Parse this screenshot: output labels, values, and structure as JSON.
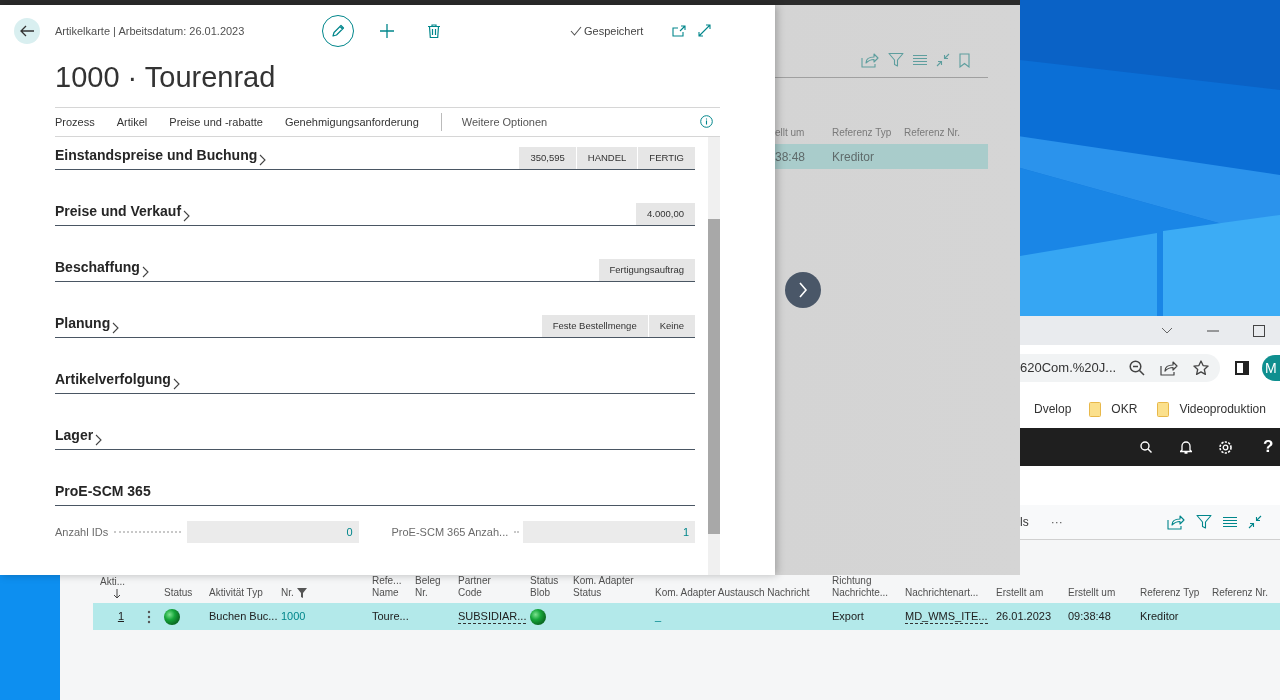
{
  "dialog": {
    "breadcrumb": "Artikelkarte | Arbeitsdatum: 26.01.2023",
    "save_status": "Gespeichert",
    "title": "1000 · Tourenrad",
    "menu": [
      {
        "label": "Prozess",
        "kind": "action"
      },
      {
        "label": "Artikel",
        "kind": "action"
      },
      {
        "label": "Preise und -rabatte",
        "kind": "action"
      },
      {
        "label": "Genehmigungsanforderung",
        "kind": "action"
      },
      {
        "label": "Weitere Optionen",
        "kind": "more"
      }
    ],
    "sections": [
      {
        "title": "Einstandspreise und Buchung",
        "expanded": false,
        "summary": [
          "350,595",
          "HANDEL",
          "FERTIG"
        ]
      },
      {
        "title": "Preise und Verkauf",
        "expanded": false,
        "summary": [
          "4.000,00"
        ]
      },
      {
        "title": "Beschaffung",
        "expanded": false,
        "summary": [
          "Fertigungsauftrag"
        ]
      },
      {
        "title": "Planung",
        "expanded": false,
        "summary": [
          "Feste Bestellmenge",
          "Keine"
        ]
      },
      {
        "title": "Artikelverfolgung",
        "expanded": false
      },
      {
        "title": "Lager",
        "expanded": false
      },
      {
        "title": "ProE-SCM 365",
        "expanded": true,
        "fields": [
          {
            "label": "Anzahl IDs",
            "value": "0"
          },
          {
            "label": "ProE-SCM 365 Anzah...",
            "value": "1"
          }
        ]
      }
    ]
  },
  "background_list": {
    "columns": [
      "ellt um",
      "Referenz Typ",
      "Referenz Nr."
    ],
    "row": {
      "selected": true,
      "cells": [
        "38:48",
        "Kreditor"
      ]
    }
  },
  "browser": {
    "address": "620Com.%20J...",
    "profile_initial": "M",
    "bookmarks": [
      "Dvelop",
      "OKR",
      "Videoproduktion"
    ],
    "help": "?",
    "actions": [
      "ls",
      "···"
    ],
    "table": {
      "columns": [
        {
          "label": [
            "Akti..."
          ],
          "sorted": true,
          "filtered": false
        },
        {
          "label": [
            "Status"
          ],
          "sorted": false,
          "filtered": false
        },
        {
          "label": [
            "Aktivität Typ"
          ],
          "sorted": false,
          "filtered": false
        },
        {
          "label": [
            "Nr."
          ],
          "sorted": false,
          "filtered": true
        },
        {
          "label": [
            "Refe...",
            "Name"
          ],
          "sorted": false,
          "filtered": false
        },
        {
          "label": [
            "Beleg",
            "Nr."
          ],
          "sorted": false,
          "filtered": false
        },
        {
          "label": [
            "Partner",
            "Code"
          ],
          "sorted": false,
          "filtered": false
        },
        {
          "label": [
            "Status",
            "Blob"
          ],
          "sorted": false,
          "filtered": false
        },
        {
          "label": [
            "Kom. Adapter",
            "Status"
          ],
          "sorted": false,
          "filtered": false
        },
        {
          "label": [
            "Kom. Adapter Austausch Nachricht"
          ],
          "sorted": false,
          "filtered": false
        },
        {
          "label": [
            "Richtung",
            "Nachrichte..."
          ],
          "sorted": false,
          "filtered": false
        },
        {
          "label": [
            "Nachrichtenart..."
          ],
          "sorted": false,
          "filtered": false
        },
        {
          "label": [
            "Erstellt am"
          ],
          "sorted": false,
          "filtered": false
        },
        {
          "label": [
            "Erstellt um"
          ],
          "sorted": false,
          "filtered": false
        },
        {
          "label": [
            "Referenz Typ"
          ],
          "sorted": false,
          "filtered": false
        },
        {
          "label": [
            "Referenz Nr."
          ],
          "sorted": false,
          "filtered": false
        }
      ],
      "rows": [
        {
          "selected": true,
          "cells": [
            {
              "kind": "underlined",
              "text": "1"
            },
            {
              "kind": "status"
            },
            {
              "kind": "text",
              "text": "Buchen Buc..."
            },
            {
              "kind": "teal",
              "text": "1000"
            },
            {
              "kind": "text",
              "text": "Toure..."
            },
            {
              "kind": "empty"
            },
            {
              "kind": "dashed",
              "text": "SUBSIDIAR..."
            },
            {
              "kind": "status"
            },
            {
              "kind": "empty"
            },
            {
              "kind": "teal",
              "text": "_"
            },
            {
              "kind": "text",
              "text": "Export"
            },
            {
              "kind": "dashed",
              "text": "MD_WMS_ITE..."
            },
            {
              "kind": "text",
              "text": "26.01.2023"
            },
            {
              "kind": "text",
              "text": "09:38:48"
            },
            {
              "kind": "text",
              "text": "Kreditor"
            },
            {
              "kind": "empty"
            }
          ]
        }
      ]
    }
  }
}
